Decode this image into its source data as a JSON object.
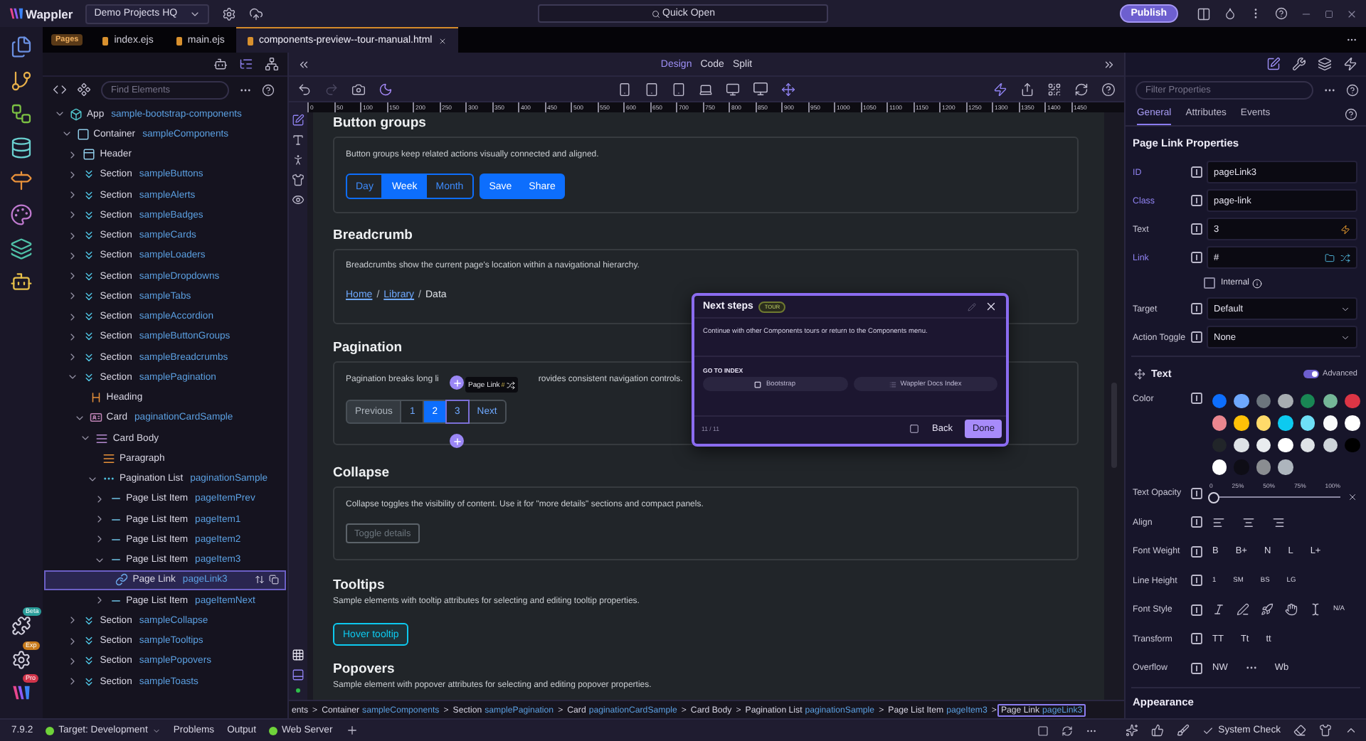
{
  "top_bar": {
    "app_name": "Wappler",
    "project": "Demo Projects HQ",
    "search": "Quick Open",
    "publish": "Publish"
  },
  "rail_badges": [
    "Beta",
    "Exp",
    "Pro"
  ],
  "file_tabs": {
    "group": "Pages",
    "tabs": [
      {
        "label": "index.ejs",
        "selected": false
      },
      {
        "label": "main.ejs",
        "selected": false
      },
      {
        "label": "components-preview--tour-manual.html",
        "selected": true
      }
    ]
  },
  "elements_panel": {
    "search": {
      "placeholder": "Find Elements"
    },
    "tree": [
      {
        "kind": "app",
        "label": "App",
        "name": "sample-bootstrap-components",
        "expanded": true,
        "selected": false,
        "children": [
          {
            "kind": "container",
            "label": "Container",
            "name": "sampleComponents",
            "expanded": true,
            "selected": false,
            "children": [
              {
                "kind": "header",
                "label": "Header",
                "expanded": false,
                "selected": false
              },
              {
                "kind": "section",
                "label": "Section",
                "name": "sampleButtons",
                "expanded": false,
                "selected": false
              },
              {
                "kind": "section",
                "label": "Section",
                "name": "sampleAlerts",
                "expanded": false,
                "selected": false
              },
              {
                "kind": "section",
                "label": "Section",
                "name": "sampleBadges",
                "expanded": false,
                "selected": false
              },
              {
                "kind": "section",
                "label": "Section",
                "name": "sampleCards",
                "expanded": false,
                "selected": false
              },
              {
                "kind": "section",
                "label": "Section",
                "name": "sampleLoaders",
                "expanded": false,
                "selected": false
              },
              {
                "kind": "section",
                "label": "Section",
                "name": "sampleDropdowns",
                "expanded": false,
                "selected": false
              },
              {
                "kind": "section",
                "label": "Section",
                "name": "sampleTabs",
                "expanded": false,
                "selected": false
              },
              {
                "kind": "section",
                "label": "Section",
                "name": "sampleAccordion",
                "expanded": false,
                "selected": false
              },
              {
                "kind": "section",
                "label": "Section",
                "name": "sampleButtonGroups",
                "expanded": false,
                "selected": false
              },
              {
                "kind": "section",
                "label": "Section",
                "name": "sampleBreadcrumbs",
                "expanded": false,
                "selected": false
              },
              {
                "kind": "section",
                "label": "Section",
                "name": "samplePagination",
                "expanded": true,
                "selected": false,
                "children": [
                  {
                    "kind": "heading",
                    "label": "Heading",
                    "selected": false
                  },
                  {
                    "kind": "card",
                    "label": "Card",
                    "name": "paginationCardSample",
                    "expanded": true,
                    "selected": false,
                    "children": [
                      {
                        "kind": "cardbody",
                        "label": "Card Body",
                        "expanded": true,
                        "selected": false,
                        "children": [
                          {
                            "kind": "paragraph",
                            "label": "Paragraph",
                            "selected": false
                          },
                          {
                            "kind": "list",
                            "label": "Pagination List",
                            "name": "paginationSample",
                            "expanded": true,
                            "selected": false,
                            "children": [
                              {
                                "kind": "item",
                                "label": "Page List Item",
                                "name": "pageItemPrev",
                                "expanded": false,
                                "selected": false
                              },
                              {
                                "kind": "item",
                                "label": "Page List Item",
                                "name": "pageItem1",
                                "expanded": false,
                                "selected": false
                              },
                              {
                                "kind": "item",
                                "label": "Page List Item",
                                "name": "pageItem2",
                                "expanded": false,
                                "selected": false
                              },
                              {
                                "kind": "item",
                                "label": "Page List Item",
                                "name": "pageItem3",
                                "expanded": true,
                                "selected": false,
                                "children": [
                                  {
                                    "kind": "link",
                                    "label": "Page Link",
                                    "name": "pageLink3",
                                    "selected": true
                                  }
                                ]
                              },
                              {
                                "kind": "item",
                                "label": "Page List Item",
                                "name": "pageItemNext",
                                "expanded": false,
                                "selected": false
                              }
                            ]
                          }
                        ]
                      }
                    ]
                  }
                ]
              },
              {
                "kind": "section",
                "label": "Section",
                "name": "sampleCollapse",
                "expanded": false,
                "selected": false
              },
              {
                "kind": "section",
                "label": "Section",
                "name": "sampleTooltips",
                "expanded": false,
                "selected": false
              },
              {
                "kind": "section",
                "label": "Section",
                "name": "samplePopovers",
                "expanded": false,
                "selected": false
              },
              {
                "kind": "section",
                "label": "Section",
                "name": "sampleToasts",
                "expanded": false,
                "selected": false
              }
            ]
          }
        ]
      }
    ]
  },
  "design_view": {
    "modes": [
      {
        "label": "Design",
        "selected": true
      },
      {
        "label": "Code",
        "selected": false
      },
      {
        "label": "Split",
        "selected": false
      }
    ],
    "ruler": [
      "0",
      "50",
      "100",
      "150",
      "200",
      "250",
      "300",
      "350",
      "400",
      "450",
      "500",
      "550",
      "600",
      "650",
      "700",
      "750",
      "800",
      "850",
      "900",
      "950",
      "1000",
      "1050",
      "1100",
      "1150",
      "1200",
      "1250",
      "1300",
      "1350",
      "1400",
      "1450"
    ],
    "sections": [
      {
        "kind": "button_groups",
        "heading": "Button groups",
        "description": "Button groups keep related actions visually connected and aligned.",
        "groups": [
          {
            "kind": "toggle",
            "buttons": [
              {
                "label": "Day",
                "selected": false
              },
              {
                "label": "Week",
                "selected": true
              },
              {
                "label": "Month",
                "selected": false
              }
            ]
          },
          {
            "kind": "solid",
            "buttons": [
              {
                "label": "Save"
              },
              {
                "label": "Share"
              }
            ]
          }
        ]
      },
      {
        "kind": "breadcrumb",
        "heading": "Breadcrumb",
        "description": "Breadcrumbs show the current page's location within a navigational hierarchy.",
        "crumbs": [
          {
            "label": "Home",
            "link": true
          },
          {
            "label": "Library",
            "link": true,
            "sep": "/"
          },
          {
            "label": "Data",
            "link": false,
            "sep": "/"
          }
        ]
      },
      {
        "kind": "pagination",
        "heading": "Pagination",
        "description_start": "Pagination breaks long li",
        "description_end": "rovides consistent navigation controls.",
        "badge": {
          "label": "Page Link",
          "value": "#"
        },
        "pages": [
          {
            "label": "Previous",
            "disabled": true,
            "active": false,
            "selected": false
          },
          {
            "label": "1",
            "disabled": false,
            "active": false,
            "selected": false
          },
          {
            "label": "2",
            "disabled": false,
            "active": true,
            "selected": false
          },
          {
            "label": "3",
            "disabled": false,
            "active": false,
            "selected": true
          },
          {
            "label": "Next",
            "disabled": false,
            "active": false,
            "selected": false
          }
        ]
      },
      {
        "kind": "collapse",
        "heading": "Collapse",
        "description": "Collapse toggles the visibility of content. Use it for \"more details\" sections and compact panels.",
        "button": "Toggle details"
      },
      {
        "kind": "tooltips",
        "heading": "Tooltips",
        "description": "Sample elements with tooltip attributes for selecting and editing tooltip properties.",
        "button": "Hover tooltip"
      },
      {
        "kind": "popovers",
        "heading": "Popovers",
        "description": "Sample element with popover attributes for selecting and editing popover properties."
      }
    ],
    "tour": {
      "title": "Next steps",
      "badge": "TOUR",
      "text": "Continue with other Components tours or return to the Components menu.",
      "section_label": "GO TO INDEX",
      "links": [
        {
          "label": "Bootstrap"
        },
        {
          "label": "Wappler Docs Index"
        }
      ],
      "progress": "11 / 11",
      "back": "Back",
      "done": "Done"
    },
    "path": [
      {
        "label": "ents",
        "selected": false
      },
      {
        "label": "Container",
        "name": "sampleComponents",
        "sep": ">",
        "selected": false
      },
      {
        "label": "Section",
        "name": "samplePagination",
        "sep": ">",
        "selected": false
      },
      {
        "label": "Card",
        "name": "paginationCardSample",
        "sep": ">",
        "selected": false
      },
      {
        "label": "Card Body",
        "sep": ">",
        "selected": false
      },
      {
        "label": "Pagination List",
        "name": "paginationSample",
        "sep": ">",
        "selected": false
      },
      {
        "label": "Page List Item",
        "name": "pageItem3",
        "sep": ">",
        "selected": false
      },
      {
        "label": "Page Link",
        "name": "pageLink3",
        "sep": ">",
        "selected": true
      }
    ]
  },
  "properties": {
    "filter": {
      "placeholder": "Filter Properties"
    },
    "tabs": [
      {
        "label": "General",
        "selected": true
      },
      {
        "label": "Attributes",
        "selected": false
      },
      {
        "label": "Events",
        "selected": false
      }
    ],
    "title": "Page Link Properties",
    "fields": [
      {
        "kind": "input",
        "label": "ID",
        "value": "pageLink3",
        "set": true
      },
      {
        "kind": "input",
        "label": "Class",
        "value": "page-link",
        "set": true
      },
      {
        "kind": "dynamic",
        "label": "Text",
        "value": "3",
        "set": false
      },
      {
        "kind": "link",
        "label": "Link",
        "value": "#",
        "set": true
      },
      {
        "kind": "checkbox",
        "label": "Internal",
        "checked": false
      },
      {
        "kind": "select",
        "label": "Target",
        "value": "Default",
        "set": false
      },
      {
        "kind": "select",
        "label": "Action Toggle",
        "value": "None",
        "set": false
      }
    ],
    "text_section": {
      "title": "Text",
      "advanced": {
        "label": "Advanced",
        "on": true
      },
      "rows": [
        {
          "kind": "colors",
          "label": "Color",
          "swatches": [
            {
              "color": "#0d6efd"
            },
            {
              "color": "#6ea8fe"
            },
            {
              "color": "#6c757d"
            },
            {
              "color": "#a7acb1"
            },
            {
              "color": "#198754"
            },
            {
              "color": "#75b798"
            },
            {
              "color": "#dc3545"
            },
            {
              "color": "#ea868f"
            },
            {
              "color": "#ffc107"
            },
            {
              "color": "#ffda6a"
            },
            {
              "color": "#0dcaf0"
            },
            {
              "color": "#6edff6"
            },
            {
              "color": "#f8f9fa"
            },
            {
              "color": "#ffffff"
            },
            {
              "color": "#212529"
            },
            {
              "color": "#dee2e6"
            },
            {
              "color": "#e9ecef"
            },
            {
              "color": "#ffffff"
            },
            {
              "color": "#dee2e6"
            },
            {
              "color": "#ced4da"
            },
            {
              "color": "#000000"
            },
            {
              "color": "#ffffff"
            },
            {
              "color": "#0e0d16"
            },
            {
              "color": "#8a8d91"
            },
            {
              "color": "#adb5bd"
            }
          ]
        },
        {
          "kind": "slider",
          "label": "Text Opacity",
          "ticks": [
            "0",
            "25%",
            "50%",
            "75%",
            "100%"
          ],
          "level": 0
        },
        {
          "kind": "align",
          "label": "Align"
        },
        {
          "kind": "options",
          "label": "Font Weight",
          "options": [
            "B",
            "B+",
            "N",
            "L",
            "L+"
          ]
        },
        {
          "kind": "options",
          "label": "Line Height",
          "options": [
            "1",
            "SM",
            "BS",
            "LG"
          ]
        },
        {
          "kind": "styles",
          "label": "Font Style",
          "options": [
            "N/A"
          ]
        },
        {
          "kind": "options",
          "label": "Transform",
          "options": [
            "TT",
            "Tt",
            "tt"
          ]
        },
        {
          "kind": "overflow",
          "label": "Overflow",
          "options": [
            "NW",
            "Wb"
          ]
        }
      ]
    },
    "next_section": "Appearance"
  },
  "status_bar": {
    "version": "7.9.2",
    "target": "Target: Development",
    "items": [
      "Problems",
      "Output"
    ],
    "server": "Web Server",
    "check": "System Check"
  }
}
